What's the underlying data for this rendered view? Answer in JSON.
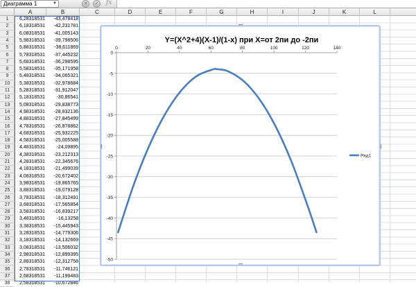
{
  "formula_bar": {
    "name_box": "Диаграмма 1",
    "cancel_icon": "close-circle-icon",
    "confirm_icon": "check-circle-icon",
    "fx_label": "fx",
    "formula": ""
  },
  "columns": [
    "A",
    "B",
    "C",
    "D",
    "E",
    "F",
    "G",
    "H",
    "I",
    "J",
    "K",
    "L"
  ],
  "rows": [
    "1",
    "2",
    "3",
    "4",
    "5",
    "6",
    "7",
    "8",
    "9",
    "10",
    "11",
    "12",
    "13",
    "14",
    "15",
    "16",
    "17",
    "18",
    "19",
    "20",
    "21",
    "22",
    "23",
    "24",
    "25",
    "26",
    "27",
    "28",
    "29",
    "30",
    "31",
    "32",
    "33",
    "34",
    "35",
    "36",
    "37",
    "38"
  ],
  "column_a": [
    "6,28318531",
    "6,18318531",
    "6,08318531",
    "5,98318531",
    "5,88318531",
    "5,78318531",
    "5,68318531",
    "5,58318531",
    "5,48318531",
    "5,38318531",
    "5,28318531",
    "5,18318531",
    "5,08318531",
    "4,98318531",
    "4,88318531",
    "4,78318531",
    "4,68318531",
    "4,58318531",
    "4,48318531",
    "4,38318531",
    "4,28318531",
    "4,18318531",
    "4,08318531",
    "3,98318531",
    "3,88318531",
    "3,78318531",
    "3,68318531",
    "3,58318531",
    "3,48318531",
    "3,38318531",
    "3,28318531",
    "3,18318531",
    "3,08318531",
    "2,98318531",
    "2,88318531",
    "2,78318531",
    "2,68318531",
    "2,58318531"
  ],
  "column_b": [
    "-43,478418",
    "-42,231781",
    "-41,005143",
    "-39,798506",
    "-38,611869",
    "-37,445232",
    "-36,298595",
    "-35,171958",
    "-34,065321",
    "-32,978684",
    "-31,912047",
    "-30,86541",
    "-29,838773",
    "-28,832136",
    "-27,845499",
    "-26,878862",
    "-25,932225",
    "-25,005588",
    "-24,09895",
    "-23,212313",
    "-22,345676",
    "-21,499039",
    "-20,672402",
    "-19,865765",
    "-19,079128",
    "-18,312491",
    "-17,565854",
    "-16,839217",
    "-16,13258",
    "-15,445943",
    "-14,779306",
    "-14,132669",
    "-13,506032",
    "-12,899395",
    "-12,312758",
    "-11,746121",
    "-11,199483",
    "-10,672846"
  ],
  "chart": {
    "title": "Y=(X^2+4)(X-1)/(1-x) при X=от 2пи до -2пи",
    "legend": "Ряд1",
    "series_color": "#4a7ebb"
  },
  "chart_data": {
    "type": "line",
    "title": "Y=(X^2+4)(X-1)/(1-x) при X=от 2пи до -2пи",
    "xlabel": "",
    "ylabel": "",
    "xlim": [
      0,
      140
    ],
    "ylim": [
      -50,
      0
    ],
    "x_ticks": [
      0,
      20,
      40,
      60,
      80,
      100,
      120,
      140
    ],
    "y_ticks": [
      0,
      -5,
      -10,
      -15,
      -20,
      -25,
      -30,
      -35,
      -40,
      -45,
      -50
    ],
    "grid": "horizontal",
    "legend_position": "right",
    "series": [
      {
        "name": "Ряд1",
        "x": [
          1,
          11,
          21,
          31,
          41,
          51,
          61,
          64,
          71,
          81,
          91,
          101,
          111,
          121,
          127
        ],
        "y": [
          -43.48,
          -31.91,
          -22.35,
          -14.78,
          -9.21,
          -5.64,
          -4.08,
          -4.0,
          -4.51,
          -6.95,
          -11.38,
          -17.81,
          -26.25,
          -36.68,
          -43.48
        ]
      }
    ]
  }
}
